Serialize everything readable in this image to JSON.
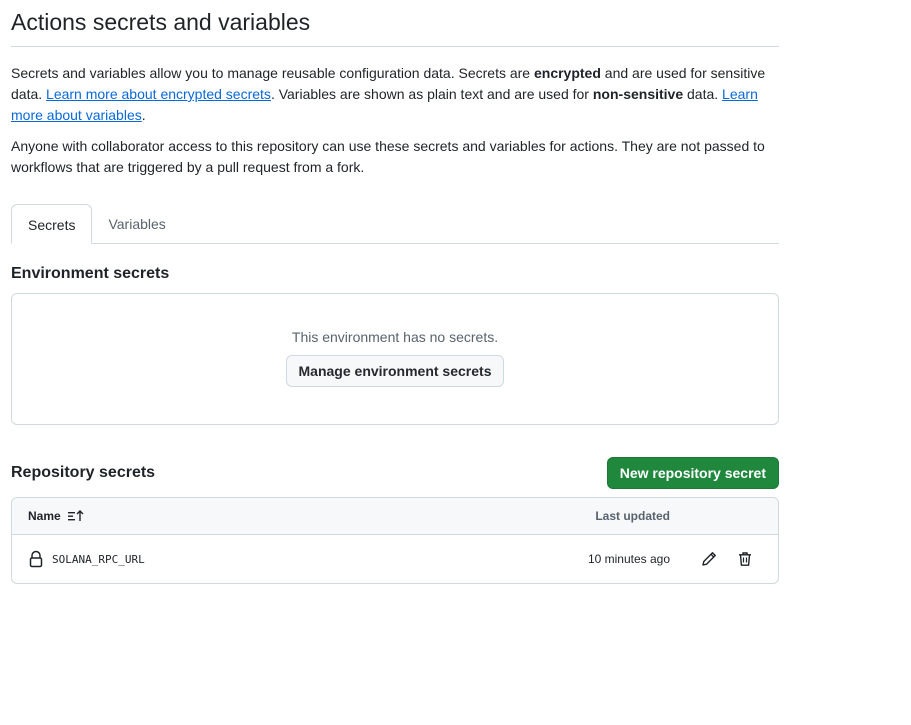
{
  "page": {
    "title": "Actions secrets and variables"
  },
  "intro": {
    "p1_text_a": "Secrets and variables allow you to manage reusable configuration data. Secrets are ",
    "p1_bold_a": "encrypted",
    "p1_text_b": " and are used for sensitive data. ",
    "p1_link_a": "Learn more about encrypted secrets",
    "p1_text_c": ". Variables are shown as plain text and are used for ",
    "p1_bold_b": "non-sensitive",
    "p1_text_d": " data. ",
    "p1_link_b": "Learn more about variables",
    "p1_text_e": ".",
    "p2": "Anyone with collaborator access to this repository can use these secrets and variables for actions. They are not passed to workflows that are triggered by a pull request from a fork."
  },
  "tabs": [
    {
      "label": "Secrets",
      "active": true
    },
    {
      "label": "Variables",
      "active": false
    }
  ],
  "environment": {
    "title": "Environment secrets",
    "empty_message": "This environment has no secrets.",
    "manage_button": "Manage environment secrets"
  },
  "repository": {
    "title": "Repository secrets",
    "new_button": "New repository secret",
    "columns": {
      "name": "Name",
      "updated": "Last updated"
    },
    "rows": [
      {
        "name": "SOLANA_RPC_URL",
        "updated": "10 minutes ago",
        "icon": "lock-icon"
      }
    ]
  },
  "colors": {
    "link": "#0969da",
    "primary_button": "#1f883d",
    "border": "#d1d9e0",
    "muted_text": "#59636e"
  }
}
